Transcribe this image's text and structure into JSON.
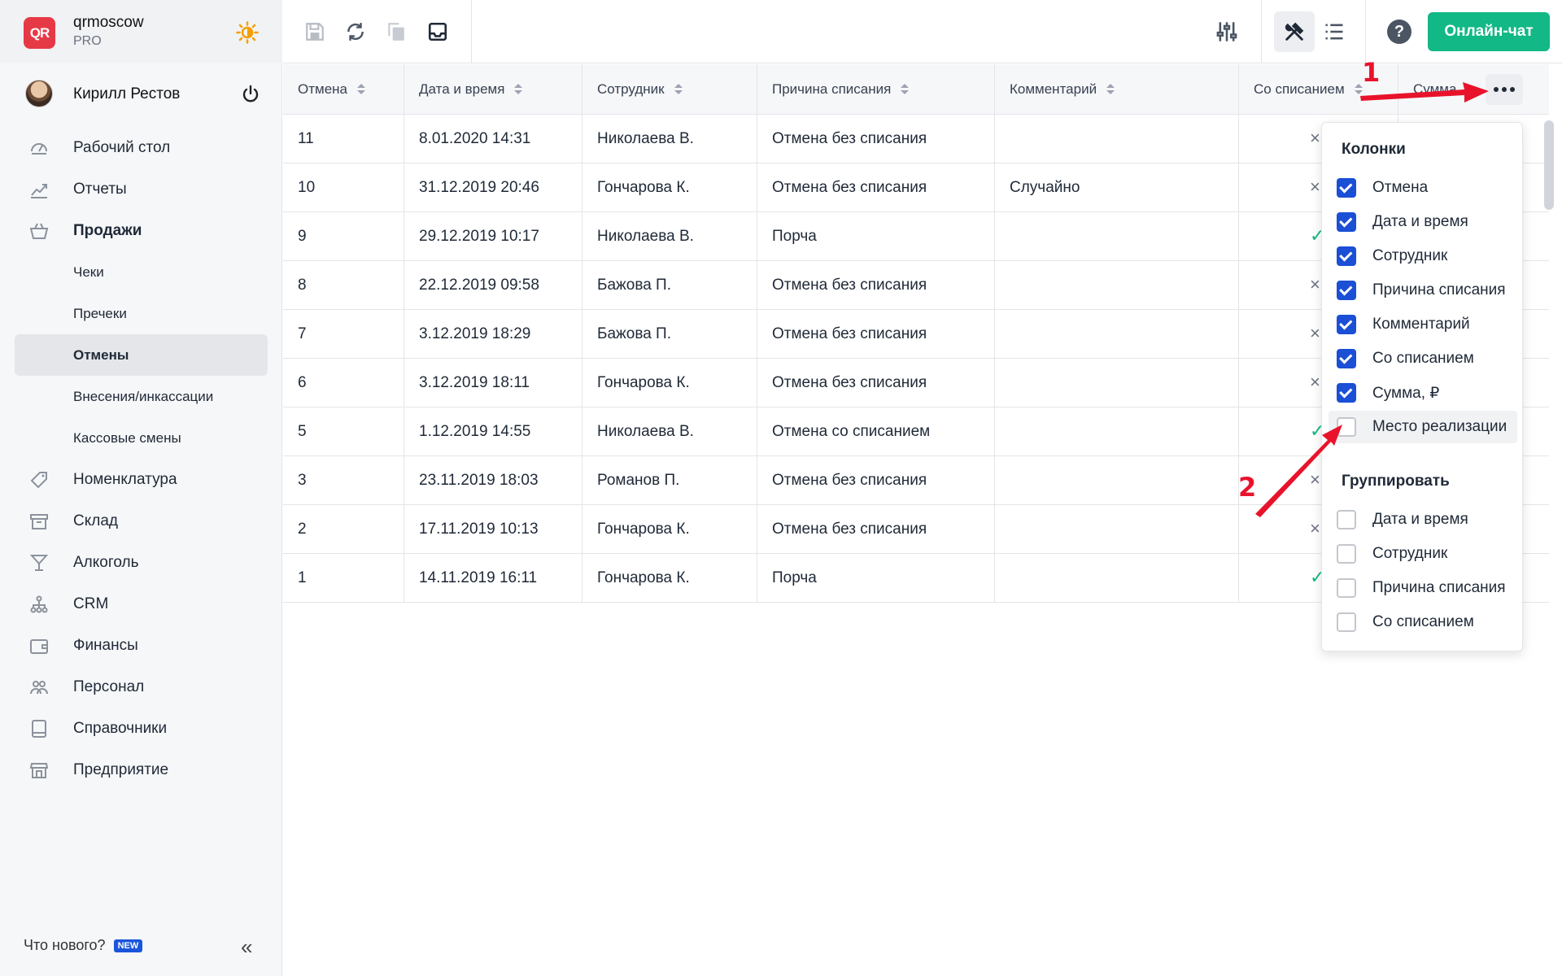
{
  "brand": {
    "name": "qrmoscow",
    "plan": "PRO",
    "logo_text": "QR"
  },
  "user": {
    "name": "Кирилл Рестов"
  },
  "nav": {
    "items": [
      {
        "label": "Рабочий стол",
        "icon": "dashboard-icon"
      },
      {
        "label": "Отчеты",
        "icon": "chart-icon"
      },
      {
        "label": "Продажи",
        "icon": "basket-icon"
      }
    ],
    "sub_items": [
      "Чеки",
      "Пречеки",
      "Отмены",
      "Внесения/инкассации",
      "Кассовые смены"
    ],
    "active_sub": "Отмены",
    "items_after": [
      {
        "label": "Номенклатура",
        "icon": "tag-icon"
      },
      {
        "label": "Склад",
        "icon": "box-icon"
      },
      {
        "label": "Алкоголь",
        "icon": "cocktail-icon"
      },
      {
        "label": "CRM",
        "icon": "network-icon"
      },
      {
        "label": "Финансы",
        "icon": "wallet-icon"
      },
      {
        "label": "Персонал",
        "icon": "people-icon"
      },
      {
        "label": "Справочники",
        "icon": "book-icon"
      },
      {
        "label": "Предприятие",
        "icon": "store-icon"
      }
    ],
    "whats_new": "Что нового?",
    "new_badge": "NEW"
  },
  "toolbar": {
    "chat_label": "Онлайн-чат",
    "help": "?"
  },
  "table": {
    "columns": [
      "Отмена",
      "Дата и время",
      "Сотрудник",
      "Причина списания",
      "Комментарий",
      "Со списанием",
      "Сумма"
    ],
    "rows": [
      {
        "id": "11",
        "datetime": "8.01.2020 14:31",
        "employee": "Николаева В.",
        "reason": "Отмена без списания",
        "comment": "",
        "writeoff": "×"
      },
      {
        "id": "10",
        "datetime": "31.12.2019 20:46",
        "employee": "Гончарова К.",
        "reason": "Отмена без списания",
        "comment": "Случайно",
        "writeoff": "×"
      },
      {
        "id": "9",
        "datetime": "29.12.2019 10:17",
        "employee": "Николаева В.",
        "reason": "Порча",
        "comment": "",
        "writeoff": "✓"
      },
      {
        "id": "8",
        "datetime": "22.12.2019 09:58",
        "employee": "Бажова П.",
        "reason": "Отмена без списания",
        "comment": "",
        "writeoff": "×"
      },
      {
        "id": "7",
        "datetime": "3.12.2019 18:29",
        "employee": "Бажова П.",
        "reason": "Отмена без списания",
        "comment": "",
        "writeoff": "×"
      },
      {
        "id": "6",
        "datetime": "3.12.2019 18:11",
        "employee": "Гончарова К.",
        "reason": "Отмена без списания",
        "comment": "",
        "writeoff": "×"
      },
      {
        "id": "5",
        "datetime": "1.12.2019 14:55",
        "employee": "Николаева В.",
        "reason": "Отмена со списанием",
        "comment": "",
        "writeoff": "✓"
      },
      {
        "id": "3",
        "datetime": "23.11.2019 18:03",
        "employee": "Романов П.",
        "reason": "Отмена без списания",
        "comment": "",
        "writeoff": "×"
      },
      {
        "id": "2",
        "datetime": "17.11.2019 10:13",
        "employee": "Гончарова К.",
        "reason": "Отмена без списания",
        "comment": "",
        "writeoff": "×"
      },
      {
        "id": "1",
        "datetime": "14.11.2019 16:11",
        "employee": "Гончарова К.",
        "reason": "Порча",
        "comment": "",
        "writeoff": "✓"
      }
    ]
  },
  "dropdown": {
    "columns_title": "Колонки",
    "columns": [
      {
        "label": "Отмена",
        "checked": true
      },
      {
        "label": "Дата и время",
        "checked": true
      },
      {
        "label": "Сотрудник",
        "checked": true
      },
      {
        "label": "Причина списания",
        "checked": true
      },
      {
        "label": "Комментарий",
        "checked": true
      },
      {
        "label": "Со списанием",
        "checked": true
      },
      {
        "label": "Сумма, ₽",
        "checked": true
      },
      {
        "label": "Место реализации",
        "checked": false
      }
    ],
    "group_title": "Группировать",
    "group": [
      {
        "label": "Дата и время",
        "checked": false
      },
      {
        "label": "Сотрудник",
        "checked": false
      },
      {
        "label": "Причина списания",
        "checked": false
      },
      {
        "label": "Со списанием",
        "checked": false
      }
    ]
  },
  "annotations": {
    "arrow1": "1",
    "arrow2": "2",
    "color": "#e8132b"
  },
  "colors": {
    "accent": "#12b886",
    "checkbox": "#1a4fd6",
    "brand": "#e63946"
  }
}
